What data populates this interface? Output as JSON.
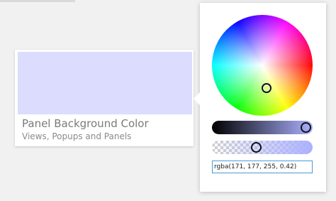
{
  "swatch": {
    "title": "Panel Background Color",
    "subtitle": "Views, Popups and Panels",
    "preview_color": "#dcdcff"
  },
  "picker": {
    "value": "rgba(171, 177, 255, 0.42)",
    "selected_rgb": "#abb1ff",
    "brightness_level": 0.9,
    "alpha_level": 0.42
  }
}
